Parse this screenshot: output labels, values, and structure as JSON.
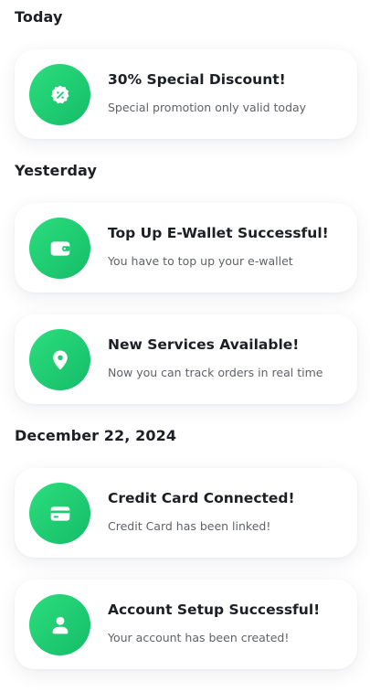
{
  "sections": [
    {
      "title": "Today",
      "items": [
        {
          "title": "30% Special Discount!",
          "subtitle": "Special promotion only valid today",
          "icon": "discount-badge-icon"
        }
      ]
    },
    {
      "title": "Yesterday",
      "items": [
        {
          "title": "Top Up E-Wallet Successful!",
          "subtitle": "You have to top up your e-wallet",
          "icon": "wallet-icon"
        },
        {
          "title": "New Services Available!",
          "subtitle": "Now you can track orders in real time",
          "icon": "location-pin-icon"
        }
      ]
    },
    {
      "title": "December 22, 2024",
      "items": [
        {
          "title": "Credit Card Connected!",
          "subtitle": "Credit Card has been linked!",
          "icon": "credit-card-icon"
        },
        {
          "title": "Account Setup Successful!",
          "subtitle": "Your account has been created!",
          "icon": "user-icon"
        }
      ]
    }
  ],
  "colors": {
    "accent_start": "#2ddd7d",
    "accent_end": "#14bd69",
    "title_text": "#1c1f24",
    "subtitle_text": "#5f6368"
  }
}
